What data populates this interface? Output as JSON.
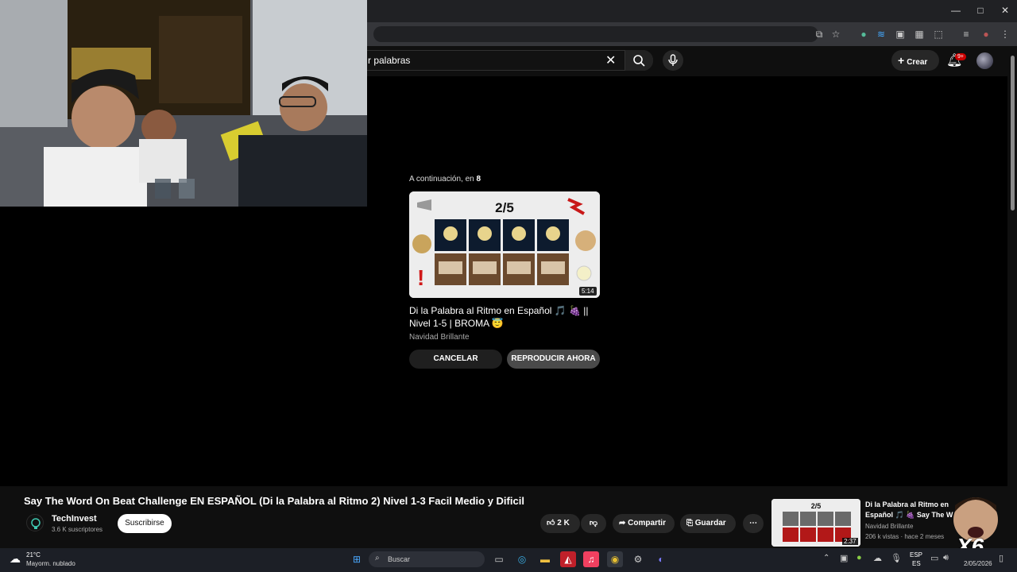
{
  "browser": {
    "window_controls": [
      "—",
      "□",
      "✕"
    ]
  },
  "youtube": {
    "search": {
      "query": "r palabras"
    },
    "create_label": "Crear",
    "notifications_badge": "9+"
  },
  "up_next": {
    "label_prefix": "A continuación, en",
    "countdown": "8",
    "thumbnail_text": "2/5",
    "thumbnail_words": [
      "LUNA",
      "CUNA"
    ],
    "duration": "5:14",
    "title": "Di la Palabra al Ritmo en Español 🎵 🍇 || Nivel 1-5 | BROMA 😇",
    "channel": "Navidad Brillante",
    "cancel_label": "CANCELAR",
    "play_label": "REPRODUCIR AHORA"
  },
  "video": {
    "title": "Say The Word On Beat Challenge EN ESPAÑOL (Di la Palabra al Ritmo 2) Nivel 1-3 Facil Medio y Dificil",
    "channel": "TechInvest",
    "subscribers": "3.6 K suscriptores",
    "subscribe_label": "Suscribirse",
    "likes": "2 K",
    "share_label": "Compartir",
    "save_label": "Guardar"
  },
  "recommendation": {
    "thumbnail_text": "2/5",
    "title": "Di la Palabra al Ritmo en Español 🎵 🍇 Say The W",
    "channel": "Navidad Brillante",
    "meta": "206 k vistas · hace 2 meses",
    "duration": "2:37"
  },
  "overlay": {
    "multiplier": "X6"
  },
  "taskbar": {
    "weather_temp": "21°C",
    "weather_desc": "Mayorm. nublado",
    "search_placeholder": "Buscar",
    "lang_top": "ESP",
    "lang_bottom": "ES",
    "date": "2/05/2026"
  },
  "colors": {
    "background": "#000000",
    "yt_surface": "#0f0f0f",
    "accent_red": "#cc0000",
    "pill": "#272727"
  }
}
